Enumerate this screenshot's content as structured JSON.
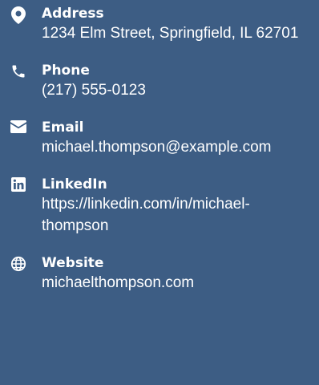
{
  "contact": {
    "address": {
      "label": "Address",
      "value": "1234 Elm Street, Springfield, IL 62701",
      "icon": "map-pin-icon"
    },
    "phone": {
      "label": "Phone",
      "value": "(217) 555-0123",
      "icon": "phone-icon"
    },
    "email": {
      "label": "Email",
      "value": "michael.thompson@example.com",
      "icon": "envelope-icon"
    },
    "linkedin": {
      "label": "LinkedIn",
      "value": "https://linkedin.com/in/michael-thompson",
      "icon": "linkedin-icon"
    },
    "website": {
      "label": "Website",
      "value": "michaelthompson.com",
      "icon": "globe-icon"
    }
  },
  "colors": {
    "background": "#3d5d84",
    "text": "#ffffff"
  }
}
